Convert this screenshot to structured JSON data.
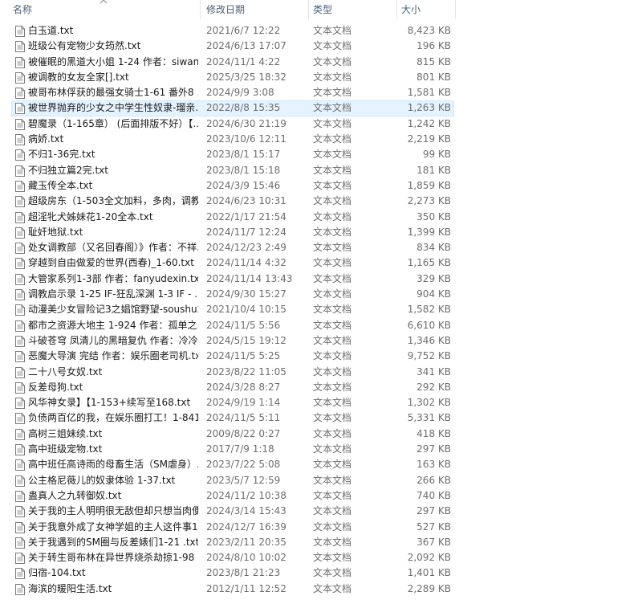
{
  "columns": {
    "name": "名称",
    "date": "修改日期",
    "type": "类型",
    "size": "大小"
  },
  "files": [
    {
      "name": "白玉道.txt",
      "date": "2021/6/7 12:22",
      "type": "文本文档",
      "size": "8,423 KB"
    },
    {
      "name": "班级公有宠物少女筠然.txt",
      "date": "2024/6/13 17:07",
      "type": "文本文档",
      "size": "196 KB"
    },
    {
      "name": "被催眠的黑道大小姐 1-24 作者：siwan...",
      "date": "2024/11/1 4:22",
      "type": "文本文档",
      "size": "815 KB"
    },
    {
      "name": "被调教的女友全家[].txt",
      "date": "2025/3/25 18:32",
      "type": "文本文档",
      "size": "801 KB"
    },
    {
      "name": "被哥布林俘获的最强女骑士1-61 番外8 ...",
      "date": "2024/9/9 3:08",
      "type": "文本文档",
      "size": "1,581 KB"
    },
    {
      "name": "被世界抛弃的少女之中学生性奴隶-瑠亲...",
      "date": "2022/8/8 15:35",
      "type": "文本文档",
      "size": "1,263 KB",
      "selected": true
    },
    {
      "name": "碧魔录（1-165章） (后面排版不好）【...",
      "date": "2024/6/30 21:19",
      "type": "文本文档",
      "size": "1,242 KB"
    },
    {
      "name": "病娇.txt",
      "date": "2023/10/6 12:11",
      "type": "文本文档",
      "size": "2,219 KB"
    },
    {
      "name": "不归1-36完.txt",
      "date": "2023/8/1 15:17",
      "type": "文本文档",
      "size": "99 KB"
    },
    {
      "name": "不归独立篇2完.txt",
      "date": "2023/8/1 15:18",
      "type": "文本文档",
      "size": "181 KB"
    },
    {
      "name": "藏玉传全本.txt",
      "date": "2024/3/9 15:46",
      "type": "文本文档",
      "size": "1,859 KB"
    },
    {
      "name": "超级房东（1-503全文加料，多肉，调教...",
      "date": "2024/6/23 10:31",
      "type": "文本文档",
      "size": "2,273 KB"
    },
    {
      "name": "超淫牝犬姊妹花1-20全本.txt",
      "date": "2022/1/17 21:54",
      "type": "文本文档",
      "size": "350 KB"
    },
    {
      "name": "耻奸地狱.txt",
      "date": "2024/11/7 12:24",
      "type": "文本文档",
      "size": "1,399 KB"
    },
    {
      "name": "处女调教部（又名回春阁）》作者：不祥...",
      "date": "2024/12/23 2:49",
      "type": "文本文档",
      "size": "834 KB"
    },
    {
      "name": "穿越到自由做爱的世界(西春)_1-60.txt",
      "date": "2024/11/14 4:32",
      "type": "文本文档",
      "size": "1,165 KB"
    },
    {
      "name": "大管家系列1-3部 作者：fanyudexin.txt",
      "date": "2024/11/14 13:43",
      "type": "文本文档",
      "size": "329 KB"
    },
    {
      "name": "调教启示录 1-25 IF-狂乱深渊 1-3 IF - ...",
      "date": "2024/9/30 15:27",
      "type": "文本文档",
      "size": "904 KB"
    },
    {
      "name": "动漫美少女冒险记3之娼馆野望-soushu2...",
      "date": "2021/10/4 10:15",
      "type": "文本文档",
      "size": "1,582 KB"
    },
    {
      "name": "都市之资源大地主 1-924 作者：孤单之...",
      "date": "2024/11/5 5:56",
      "type": "文本文档",
      "size": "6,610 KB"
    },
    {
      "name": "斗破苍穹 凤清儿的黑暗复仇 作者：冷冷...",
      "date": "2024/5/15 19:12",
      "type": "文本文档",
      "size": "1,346 KB"
    },
    {
      "name": "恶魔大导演 完结 作者：娱乐圈老司机.txt",
      "date": "2024/11/5 5:25",
      "type": "文本文档",
      "size": "9,752 KB"
    },
    {
      "name": "二十八号女奴.txt",
      "date": "2023/8/22 11:05",
      "type": "文本文档",
      "size": "341 KB"
    },
    {
      "name": "反差母狗.txt",
      "date": "2024/3/28 8:27",
      "type": "文本文档",
      "size": "292 KB"
    },
    {
      "name": "风华神女录】【1-153+续写至168.txt",
      "date": "2024/9/19 1:14",
      "type": "文本文档",
      "size": "1,302 KB"
    },
    {
      "name": "负债两百亿的我，在娱乐圈打工！1-841 ...",
      "date": "2024/11/5 5:11",
      "type": "文本文档",
      "size": "5,331 KB"
    },
    {
      "name": "高树三姐妹续.txt",
      "date": "2009/8/22 0:27",
      "type": "文本文档",
      "size": "418 KB"
    },
    {
      "name": "高中班级宠物.txt",
      "date": "2017/7/9 1:18",
      "type": "文本文档",
      "size": "297 KB"
    },
    {
      "name": "高中班任高诗雨的母畜生活（SM虐身）...",
      "date": "2023/7/22 5:08",
      "type": "文本文档",
      "size": "163 KB"
    },
    {
      "name": "公主格尼薇儿的奴隶体验 1-37.txt",
      "date": "2023/5/7 12:59",
      "type": "文本文档",
      "size": "266 KB"
    },
    {
      "name": "蛊真人之九转御奴.txt",
      "date": "2024/11/2 10:38",
      "type": "文本文档",
      "size": "740 KB"
    },
    {
      "name": "关于我的主人明明很无敌但却只想当肉便...",
      "date": "2024/3/14 15:43",
      "type": "文本文档",
      "size": "297 KB"
    },
    {
      "name": "关于我意外成了女神学姐的主人这件事1-...",
      "date": "2024/12/7 16:39",
      "type": "文本文档",
      "size": "527 KB"
    },
    {
      "name": "关于我遇到的SM圈与反差婊们1-21 .txt",
      "date": "2023/2/11 20:35",
      "type": "文本文档",
      "size": "367 KB"
    },
    {
      "name": "关于转生哥布林在异世界烧杀劫掠1-98 ...",
      "date": "2024/8/10 10:02",
      "type": "文本文档",
      "size": "2,092 KB"
    },
    {
      "name": "归宿-104.txt",
      "date": "2023/8/1 21:23",
      "type": "文本文档",
      "size": "1,401 KB"
    },
    {
      "name": "海滨的暖阳生活.txt",
      "date": "2012/1/11 12:52",
      "type": "文本文档",
      "size": "2,289 KB"
    }
  ]
}
